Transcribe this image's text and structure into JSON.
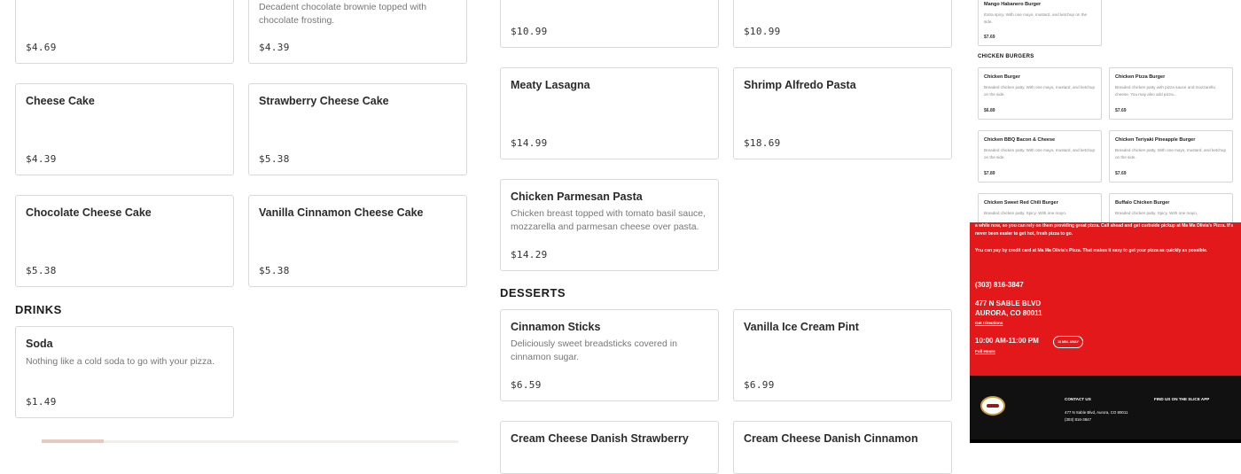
{
  "left_column": {
    "cards": [
      {
        "name": "",
        "desc": "",
        "price": "$4.69"
      },
      {
        "name": "",
        "desc": "Decadent chocolate brownie topped with chocolate frosting.",
        "price": "$4.39"
      },
      {
        "name": "Cheese Cake",
        "desc": "",
        "price": "$4.39"
      },
      {
        "name": "Strawberry Cheese Cake",
        "desc": "",
        "price": "$5.38"
      },
      {
        "name": "Chocolate Cheese Cake",
        "desc": "",
        "price": "$5.38"
      },
      {
        "name": "Vanilla Cinnamon Cheese Cake",
        "desc": "",
        "price": "$5.38"
      }
    ],
    "drinks_heading": "DRINKS",
    "drinks": [
      {
        "name": "Soda",
        "desc": "Nothing like a cold soda to go with your pizza.",
        "price": "$1.49"
      }
    ]
  },
  "middle_column": {
    "cards": [
      {
        "name": "",
        "desc": "",
        "price": "$10.99"
      },
      {
        "name": "",
        "desc": "",
        "price": "$10.99"
      },
      {
        "name": "Meaty Lasagna",
        "desc": "",
        "price": "$14.99"
      },
      {
        "name": "Shrimp Alfredo Pasta",
        "desc": "",
        "price": "$18.69"
      },
      {
        "name": "Chicken Parmesan Pasta",
        "desc": "Chicken breast topped with tomato basil sauce, mozzarella and parmesan cheese over pasta.",
        "price": "$14.29"
      }
    ],
    "desserts_heading": "DESSERTS",
    "desserts": [
      {
        "name": "Cinnamon Sticks",
        "desc": "Deliciously sweet breadsticks covered in cinnamon sugar.",
        "price": "$6.59"
      },
      {
        "name": "Vanilla Ice Cream Pint",
        "desc": "",
        "price": "$6.99"
      },
      {
        "name": "Cream Cheese Danish Strawberry",
        "desc": "",
        "price": ""
      },
      {
        "name": "Cream Cheese Danish Cinnamon",
        "desc": "",
        "price": ""
      }
    ]
  },
  "mini_panel": {
    "top_card": {
      "name": "Mango Habanero Burger",
      "desc": "Extra spicy. With one mayo, mustard, and ketchup on the side.",
      "price": "$7.69"
    },
    "chicken_heading": "CHICKEN BURGERS",
    "cards": [
      {
        "name": "Chicken Burger",
        "desc": "Breaded chicken patty. With one mayo, mustard, and ketchup on the side.",
        "price": "$6.89"
      },
      {
        "name": "Chicken Pizza Burger",
        "desc": "Breaded chicken patty with pizza sauce and mozzarella cheese. You may also add pizza...",
        "price": "$7.69"
      },
      {
        "name": "Chicken BBQ Bacon & Cheese",
        "desc": "Breaded chicken patty. With one mayo, mustard, and ketchup on the side.",
        "price": "$7.89"
      },
      {
        "name": "Chicken Teriyaki Pineapple Burger",
        "desc": "Breaded chicken patty. With one mayo, mustard, and ketchup on the side.",
        "price": "$7.69"
      },
      {
        "name": "Chicken Sweet Red Chili Burger",
        "desc": "Breaded chicken patty. Spicy. With one mayo,",
        "price": ""
      },
      {
        "name": "Buffalo Chicken Burger",
        "desc": "Breaded chicken patty. Spicy. With one mayo,",
        "price": ""
      }
    ],
    "red": {
      "para1": "a while now, so you can rely on them providing great pizza. Call ahead and get curbside pickup at Ma Ma Olivia's Pizza. It's never been easier to get hot, fresh pizza to go.",
      "para2": "You can pay by credit card at Ma Ma Olivia's Pizza. That makes it easy to get your pizza as quickly as possible.",
      "phone": "(303) 816-3847",
      "addr1": "477 N SABLE BLVD",
      "addr2": "AURORA, CO 80011",
      "directions": "Get Directions",
      "hours": "10:00 AM-11:00 PM",
      "badge": "16 MIN. AWAY",
      "full_hours": "Full Hours"
    },
    "footer": {
      "contact": "CONTACT US",
      "find": "FIND US ON THE SLICE APP",
      "address": "477 N Sable Blvd, Aurora, CO 80011",
      "phone": "(303) 816-3847"
    }
  }
}
